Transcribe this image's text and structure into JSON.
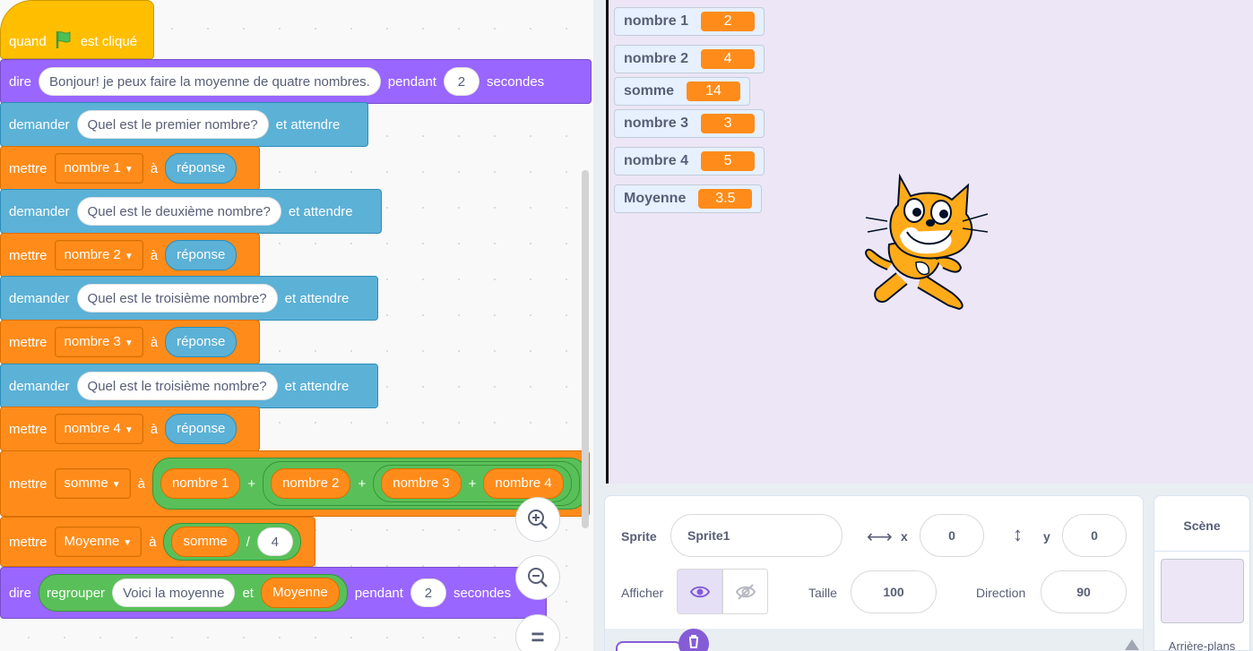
{
  "code": {
    "hat": {
      "label_before": "quand",
      "label_after": "est cliqué"
    },
    "say1": {
      "verb": "dire",
      "message": "Bonjour! je peux faire la moyenne de quatre nombres.",
      "for_label": "pendant",
      "secs": "2",
      "unit": "secondes"
    },
    "ask1": {
      "verb": "demander",
      "question": "Quel est le premier nombre?",
      "tail": "et attendre"
    },
    "set1": {
      "verb": "mettre",
      "var": "nombre 1",
      "to": "à",
      "value": "réponse"
    },
    "ask2": {
      "verb": "demander",
      "question": "Quel est le deuxième nombre?",
      "tail": "et attendre"
    },
    "set2": {
      "verb": "mettre",
      "var": "nombre 2",
      "to": "à",
      "value": "réponse"
    },
    "ask3": {
      "verb": "demander",
      "question": "Quel est le troisième nombre?",
      "tail": "et attendre"
    },
    "set3": {
      "verb": "mettre",
      "var": "nombre 3",
      "to": "à",
      "value": "réponse"
    },
    "ask4": {
      "verb": "demander",
      "question": "Quel est le troisième nombre?",
      "tail": "et attendre"
    },
    "set4": {
      "verb": "mettre",
      "var": "nombre 4",
      "to": "à",
      "value": "réponse"
    },
    "set_sum": {
      "verb": "mettre",
      "var": "somme",
      "to": "à",
      "a": "nombre 1",
      "b": "nombre 2",
      "c": "nombre 3",
      "d": "nombre 4",
      "plus": "+"
    },
    "set_avg": {
      "verb": "mettre",
      "var": "Moyenne",
      "to": "à",
      "num": "somme",
      "div": "/",
      "den": "4"
    },
    "say2": {
      "verb": "dire",
      "join": "regrouper",
      "text": "Voici la moyenne",
      "and": "et",
      "var": "Moyenne",
      "for_label": "pendant",
      "secs": "2",
      "unit": "secondes"
    }
  },
  "zoom": {
    "in_icon": "zoom-in-icon",
    "out_icon": "zoom-out-icon",
    "reset_label": "="
  },
  "monitors": [
    {
      "name": "nombre 1",
      "value": "2"
    },
    {
      "name": "nombre 2",
      "value": "4"
    },
    {
      "name": "somme",
      "value": "14"
    },
    {
      "name": "nombre 3",
      "value": "3"
    },
    {
      "name": "nombre 4",
      "value": "5"
    },
    {
      "name": "Moyenne",
      "value": "3.5"
    }
  ],
  "sprite_info": {
    "sprite_label": "Sprite",
    "sprite_name": "Sprite1",
    "x_label": "x",
    "x": "0",
    "y_label": "y",
    "y": "0",
    "show_label": "Afficher",
    "size_label": "Taille",
    "size": "100",
    "direction_label": "Direction",
    "direction": "90"
  },
  "stage_pane": {
    "title": "Scène",
    "backdrops_label": "Arrière-plans"
  },
  "colors": {
    "looks": "#9966ff",
    "sensing": "#5cb1d6",
    "variables": "#ff8c1a",
    "events": "#ffbf00",
    "operators": "#59c059",
    "stage": "#ece6f6"
  }
}
